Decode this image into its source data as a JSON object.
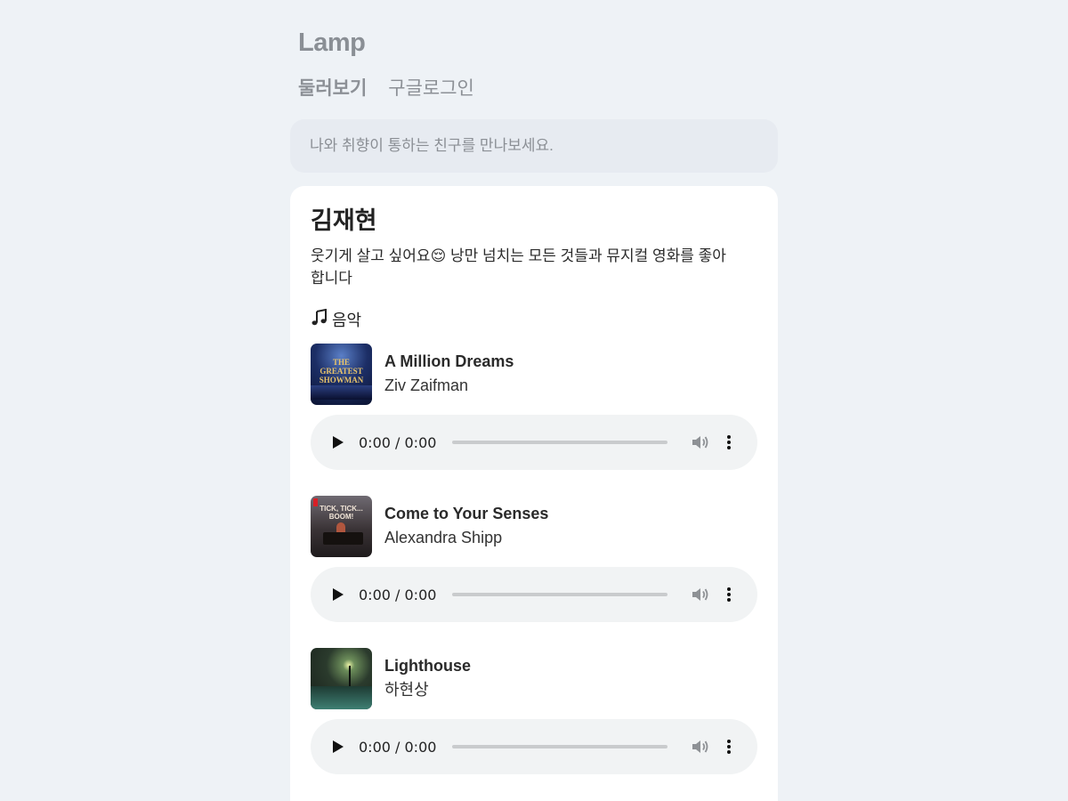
{
  "brand": "Lamp",
  "nav": {
    "browse": "둘러보기",
    "google_login": "구글로그인"
  },
  "search": {
    "placeholder": "나와 취향이 통하는 친구를 만나보세요."
  },
  "profile": {
    "name": "김재현",
    "bio": "웃기게 살고 싶어요😌 낭만 넘치는 모든 것들과 뮤지컬 영화를 좋아합니다"
  },
  "music": {
    "section_icon": "music-note-icon",
    "section_title": "음악",
    "tracks": [
      {
        "title": "A Million Dreams",
        "artist": "Ziv Zaifman",
        "time": "0:00 / 0:00",
        "cover_text": "THE GREATEST SHOWMAN"
      },
      {
        "title": "Come to Your Senses",
        "artist": "Alexandra Shipp",
        "time": "0:00 / 0:00",
        "cover_text": "TICK, TICK... BOOM!"
      },
      {
        "title": "Lighthouse",
        "artist": "하현상",
        "time": "0:00 / 0:00"
      }
    ]
  },
  "colors": {
    "background": "#eef2f6",
    "card": "#ffffff",
    "search_bg": "#e7ebf1",
    "player_bg": "#f1f3f4",
    "muted_text": "#8c9096"
  }
}
